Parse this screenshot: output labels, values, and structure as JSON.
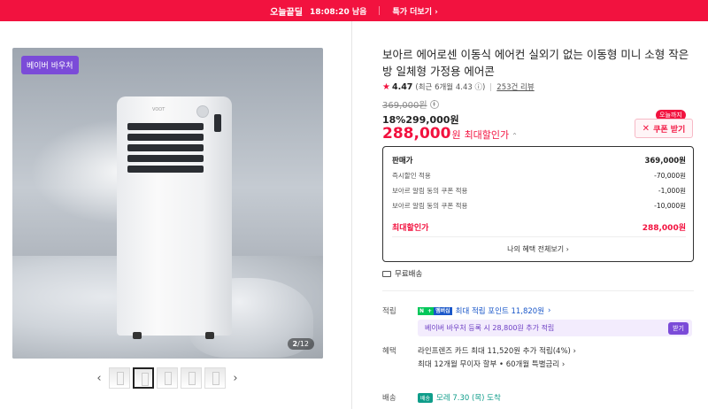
{
  "topbar": {
    "logo": "오늘끝딜",
    "timer": "18:08:20 남음",
    "link": "특가 더보기"
  },
  "gallery": {
    "voucher_badge": "베이버 바우처",
    "brand_text": "VOOT",
    "counter_current": "2",
    "counter_total": "12",
    "prev": "‹",
    "next": "›"
  },
  "product": {
    "title": "보아르 에어로센 이동식 에어컨 실외기 없는 이동형 미니 소형 작은 방 일체형 가정용 에어콘",
    "rating": "4.47",
    "rating_recent": "(최근 6개월 4.43",
    "review_count": "253건 리뷰",
    "original_price": "369,000원",
    "discount_rate": "18%",
    "discount_price": "299,000원",
    "final_price": "288,000",
    "final_won": "원",
    "final_label": "최대할인가"
  },
  "coupon": {
    "tag": "오늘까지",
    "button": "쿠폰 받기"
  },
  "price_box": {
    "rows": [
      {
        "label": "판매가",
        "value": "369,000원"
      },
      {
        "label": "즉시할인 적용",
        "value": "-70,000원"
      },
      {
        "label": "보아르 알림 동의 쿠폰 적용",
        "value": "-1,000원"
      },
      {
        "label": "보아르 알림 동의 쿠폰 적용",
        "value": "-10,000원"
      }
    ],
    "max_label": "최대할인가",
    "max_value": "288,000원",
    "all_benefits": "나의 혜택 전체보기"
  },
  "shipping_free": "무료배송",
  "points": {
    "label": "적립",
    "npay": "N",
    "npay_plus": "+",
    "membership": "멤버십",
    "text": "최대 적립 포인트 11,820원",
    "voucher_text": "베이버 바우처 등록 시 28,800원 추가 적립",
    "voucher_button": "받기"
  },
  "benefits": {
    "label": "혜택",
    "line1": "라인프렌즈 카드 최대 11,520원 추가 적립(4%)",
    "line2": "최대 12개월 무이자 할부 • 60개월 특별금리"
  },
  "delivery": {
    "label": "배송",
    "tag": "배송",
    "text": "모레 7.30 (목) 도착"
  }
}
